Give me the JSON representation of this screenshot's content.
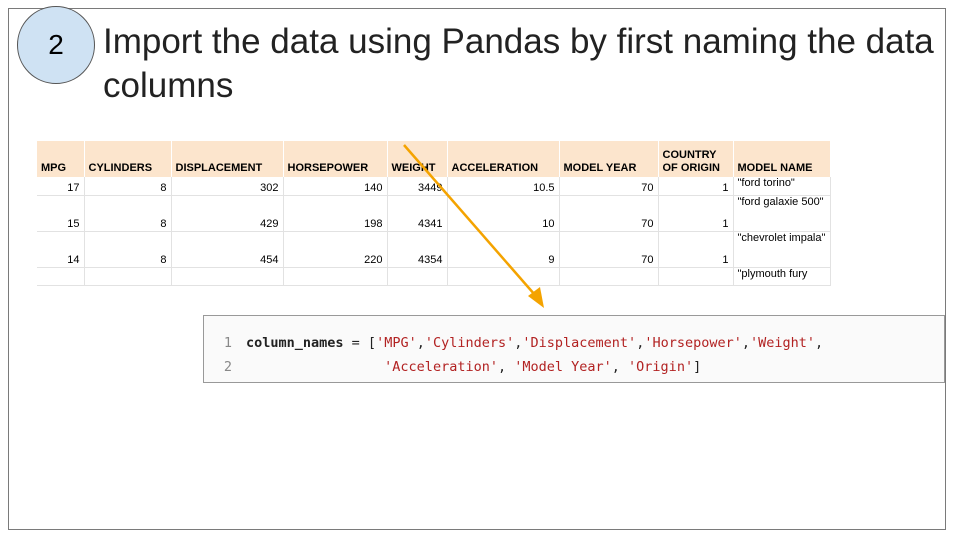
{
  "slide": {
    "step_number": "2",
    "title": "Import the data using Pandas by first naming the data columns"
  },
  "table": {
    "headers": [
      "MPG",
      "CYLINDERS",
      "DISPLACEMENT",
      "HORSEPOWER",
      "WEIGHT",
      "ACCELERATION",
      "MODEL YEAR",
      "COUNTRY OF ORIGIN",
      "MODEL NAME"
    ],
    "rows": [
      [
        "17",
        "8",
        "302",
        "140",
        "3449",
        "10.5",
        "70",
        "1",
        "\"ford torino\""
      ],
      [
        "15",
        "8",
        "429",
        "198",
        "4341",
        "10",
        "70",
        "1",
        "\"ford galaxie 500\""
      ],
      [
        "14",
        "8",
        "454",
        "220",
        "4354",
        "9",
        "70",
        "1",
        "\"chevrolet impala\""
      ],
      [
        "",
        "",
        "",
        "",
        "",
        "",
        "",
        "",
        "\"plymouth fury"
      ]
    ]
  },
  "code": {
    "line1_no": "1",
    "line2_no": "2",
    "var": "column_names",
    "op": " = [",
    "names": [
      "'MPG'",
      "'Cylinders'",
      "'Displacement'",
      "'Horsepower'",
      "'Weight'",
      "'Acceleration'",
      "'Model Year'",
      "'Origin'"
    ],
    "line2_indent": "                 ",
    "sep_tight": ",",
    "sep_space": ", ",
    "close": "]"
  },
  "colors": {
    "header_fill": "#fce5cd",
    "badge_fill": "#cfe2f3",
    "arrow": "#f4a300",
    "string": "#b22222"
  }
}
